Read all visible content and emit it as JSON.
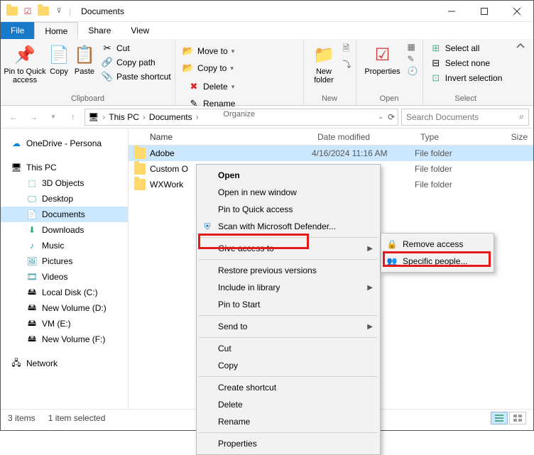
{
  "title": "Documents",
  "tabs": {
    "file": "File",
    "home": "Home",
    "share": "Share",
    "view": "View"
  },
  "ribbon": {
    "clipboard": {
      "label": "Clipboard",
      "pin": "Pin to Quick\naccess",
      "copy": "Copy",
      "paste": "Paste",
      "cut": "Cut",
      "copypath": "Copy path",
      "pasteshortcut": "Paste shortcut"
    },
    "organize": {
      "label": "Organize",
      "moveto": "Move to",
      "copyto": "Copy to",
      "delete": "Delete",
      "rename": "Rename"
    },
    "new": {
      "label": "New",
      "newfolder": "New\nfolder"
    },
    "open": {
      "label": "Open",
      "properties": "Properties"
    },
    "select": {
      "label": "Select",
      "selectall": "Select all",
      "selectnone": "Select none",
      "invert": "Invert selection"
    }
  },
  "breadcrumb": {
    "root": "This PC",
    "current": "Documents"
  },
  "search_placeholder": "Search Documents",
  "tree": {
    "onedrive": "OneDrive - Persona",
    "thispc": "This PC",
    "items": [
      "3D Objects",
      "Desktop",
      "Documents",
      "Downloads",
      "Music",
      "Pictures",
      "Videos",
      "Local Disk (C:)",
      "New Volume (D:)",
      "VM (E:)",
      "New Volume (F:)"
    ],
    "network": "Network"
  },
  "list": {
    "headers": {
      "name": "Name",
      "date": "Date modified",
      "type": "Type",
      "size": "Size"
    },
    "rows": [
      {
        "name": "Adobe",
        "date": "4/16/2024 11:16 AM",
        "type": "File folder"
      },
      {
        "name": "Custom O",
        "date": "",
        "type": "File folder"
      },
      {
        "name": "WXWork",
        "date": "",
        "type": "File folder"
      }
    ]
  },
  "context": {
    "open": "Open",
    "opennew": "Open in new window",
    "pinquick": "Pin to Quick access",
    "defender": "Scan with Microsoft Defender...",
    "giveaccess": "Give access to",
    "restore": "Restore previous versions",
    "include": "Include in library",
    "pinstart": "Pin to Start",
    "sendto": "Send to",
    "cut": "Cut",
    "copy": "Copy",
    "shortcut": "Create shortcut",
    "delete": "Delete",
    "rename": "Rename",
    "properties": "Properties",
    "removeaccess": "Remove access",
    "specificpeople": "Specific people..."
  },
  "status": {
    "items": "3 items",
    "selected": "1 item selected"
  }
}
